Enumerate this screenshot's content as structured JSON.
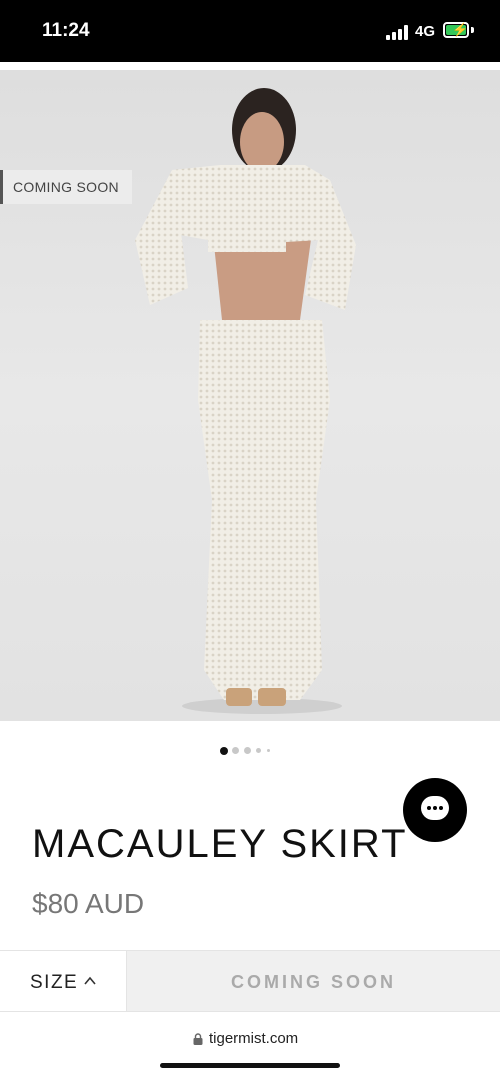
{
  "status_bar": {
    "time": "11:24",
    "network": "4G"
  },
  "product": {
    "badge": "COMING SOON",
    "title": "MACAULEY SKIRT",
    "price": "$80 AUD",
    "image_dots": {
      "count": 5,
      "active_index": 0
    }
  },
  "actions": {
    "size_label": "SIZE",
    "cta_label": "COMING SOON"
  },
  "browser": {
    "url": "tigermist.com"
  },
  "icons": {
    "signal": "cellular-signal-icon",
    "battery": "battery-charging-icon",
    "chat": "chat-bubble-icon",
    "chevron": "chevron-up-icon",
    "lock": "lock-icon"
  },
  "colors": {
    "battery_fill": "#35c759",
    "cta_disabled": "#f0f0f0"
  }
}
